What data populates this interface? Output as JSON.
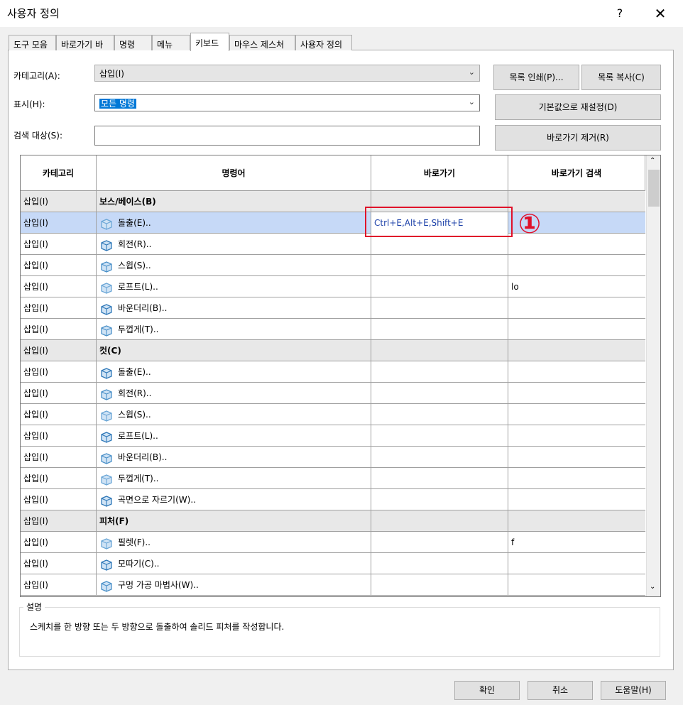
{
  "window": {
    "title": "사용자 정의",
    "help": "?",
    "close": "✕"
  },
  "tabs": [
    "도구 모음",
    "바로가기 바",
    "명령",
    "메뉴",
    "키보드",
    "마우스 제스처",
    "사용자 정의"
  ],
  "active_tab": "키보드",
  "form": {
    "category_label": "카테고리(A):",
    "category_value": "삽입(I)",
    "show_label": "표시(H):",
    "show_value": "모든 명령",
    "search_label": "검색 대상(S):",
    "search_value": ""
  },
  "buttons": {
    "print_list": "목록 인쇄(P)...",
    "copy_list": "목록 복사(C)",
    "reset_defaults": "기본값으로 재설정(D)",
    "remove_shortcut": "바로가기 제거(R)"
  },
  "table": {
    "headers": [
      "카테고리",
      "명령어",
      "바로가기",
      "바로가기 검색"
    ],
    "rows": [
      {
        "cat": "삽입(I)",
        "cmd": "보스/베이스(B)",
        "group": true
      },
      {
        "cat": "삽입(I)",
        "cmd": "돌출(E)..",
        "icon": "extrude-boss-icon",
        "shortcut": "Ctrl+E,Alt+E,Shift+E",
        "search": "",
        "selected": true
      },
      {
        "cat": "삽입(I)",
        "cmd": "회전(R)..",
        "icon": "revolve-boss-icon",
        "shortcut": "",
        "search": ""
      },
      {
        "cat": "삽입(I)",
        "cmd": "스윕(S)..",
        "icon": "sweep-boss-icon",
        "shortcut": "",
        "search": ""
      },
      {
        "cat": "삽입(I)",
        "cmd": "로프트(L)..",
        "icon": "loft-boss-icon",
        "shortcut": "",
        "search": "lo"
      },
      {
        "cat": "삽입(I)",
        "cmd": "바운더리(B)..",
        "icon": "boundary-boss-icon",
        "shortcut": "",
        "search": ""
      },
      {
        "cat": "삽입(I)",
        "cmd": "두껍게(T)..",
        "icon": "thicken-icon",
        "shortcut": "",
        "search": ""
      },
      {
        "cat": "삽입(I)",
        "cmd": "컷(C)",
        "group": true
      },
      {
        "cat": "삽입(I)",
        "cmd": "돌출(E)..",
        "icon": "extrude-cut-icon",
        "shortcut": "",
        "search": ""
      },
      {
        "cat": "삽입(I)",
        "cmd": "회전(R)..",
        "icon": "revolve-cut-icon",
        "shortcut": "",
        "search": ""
      },
      {
        "cat": "삽입(I)",
        "cmd": "스윕(S)..",
        "icon": "sweep-cut-icon",
        "shortcut": "",
        "search": ""
      },
      {
        "cat": "삽입(I)",
        "cmd": "로프트(L)..",
        "icon": "loft-cut-icon",
        "shortcut": "",
        "search": ""
      },
      {
        "cat": "삽입(I)",
        "cmd": "바운더리(B)..",
        "icon": "boundary-cut-icon",
        "shortcut": "",
        "search": ""
      },
      {
        "cat": "삽입(I)",
        "cmd": "두껍게(T)..",
        "icon": "thicken-cut-icon",
        "shortcut": "",
        "search": ""
      },
      {
        "cat": "삽입(I)",
        "cmd": "곡면으로 자르기(W)..",
        "icon": "surface-cut-icon",
        "shortcut": "",
        "search": ""
      },
      {
        "cat": "삽입(I)",
        "cmd": "피처(F)",
        "group": true
      },
      {
        "cat": "삽입(I)",
        "cmd": "필렛(F)..",
        "icon": "fillet-icon",
        "shortcut": "",
        "search": "f"
      },
      {
        "cat": "삽입(I)",
        "cmd": "모따기(C)..",
        "icon": "chamfer-icon",
        "shortcut": "",
        "search": ""
      },
      {
        "cat": "삽입(I)",
        "cmd": "구멍 가공 마법사(W)..",
        "icon": "hole-wizard-icon",
        "shortcut": "",
        "search": ""
      }
    ]
  },
  "annotation": {
    "marker": "①",
    "color": "#e0102a"
  },
  "description": {
    "label": "설명",
    "text": "스케치를 한 방향 또는 두 방향으로 돌출하여 솔리드 피처를 작성합니다."
  },
  "footer": {
    "ok": "확인",
    "cancel": "취소",
    "help": "도움말(H)"
  },
  "colors": {
    "selection": "#c6d9f7",
    "highlight_text": "#0078d7",
    "group_row": "#e8e8e8"
  }
}
